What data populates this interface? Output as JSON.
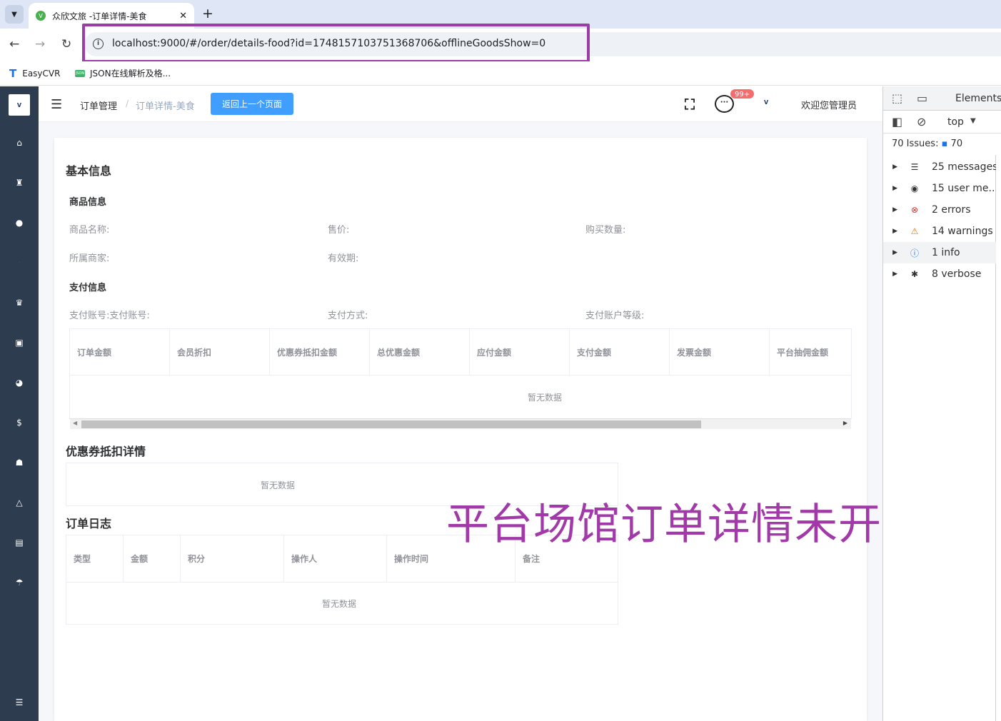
{
  "browser": {
    "tab_title": "众欣文旅 -订单详情-美食",
    "url": "localhost:9000/#/order/details-food?id=1748157103751368706&offlineGoodsShow=0",
    "bookmarks": [
      "EasyCVR",
      "JSON在线解析及格..."
    ]
  },
  "header": {
    "breadcrumb": [
      "订单管理",
      "订单详情-美食"
    ],
    "breadcrumb_sep": "/",
    "back_button": "返回上一个页面",
    "message_badge": "99+",
    "welcome": "欢迎您管理员"
  },
  "basic_info": {
    "title": "基本信息",
    "product_title": "商品信息",
    "product_name": "商品名称:",
    "price": "售价:",
    "quantity": "购买数量:",
    "merchant": "所属商家:",
    "validity": "有效期:",
    "payment_title": "支付信息",
    "pay_account": "支付账号:支付账号:",
    "pay_method": "支付方式:",
    "pay_level": "支付账户等级:"
  },
  "amount_table": {
    "columns": [
      "订单金额",
      "会员折扣",
      "优惠券抵扣金额",
      "总优惠金额",
      "应付金额",
      "支付金额",
      "发票金额",
      "平台抽佣金额"
    ],
    "empty": "暂无数据"
  },
  "coupon_section": {
    "title": "优惠券抵扣详情",
    "empty": "暂无数据"
  },
  "log_section": {
    "title": "订单日志",
    "columns": [
      "类型",
      "金额",
      "积分",
      "操作人",
      "操作时间",
      "备注"
    ],
    "empty": "暂无数据"
  },
  "annotation": "平台场馆订单详情未开发",
  "devtools": {
    "tab_elements": "Elements",
    "context": "top",
    "issues_label": "70 Issues:",
    "issues_count": "70",
    "rows": [
      "25 messages",
      "15 user me...",
      "2 errors",
      "14 warnings",
      "1 info",
      "8 verbose"
    ]
  },
  "colors": {
    "primary": "#409eff",
    "sidebar": "#2e3c50",
    "annotation": "#a13aa8",
    "badge": "#f56c6c"
  }
}
